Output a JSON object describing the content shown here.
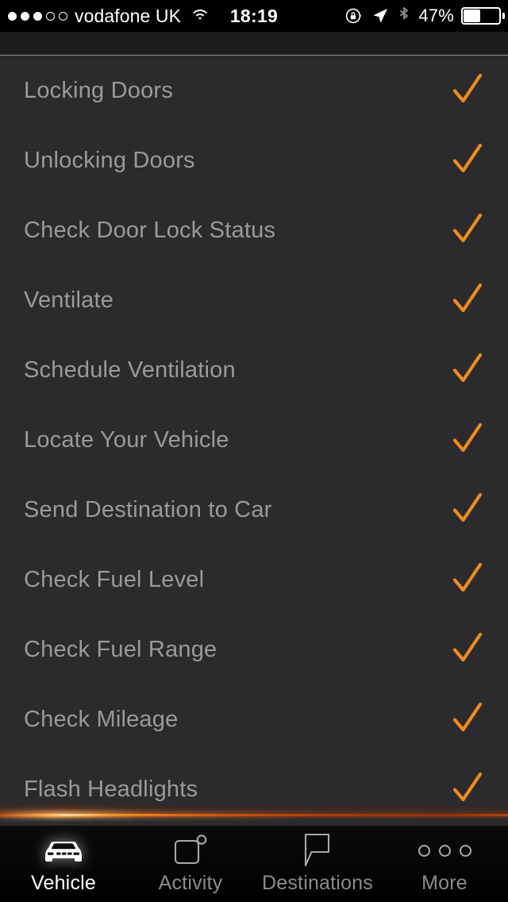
{
  "statusbar": {
    "signal_dots_filled": 3,
    "signal_dots_total": 5,
    "carrier": "vodafone UK",
    "wifi_icon": "wifi-icon",
    "time": "18:19",
    "rotation_lock_icon": "rotation-lock-icon",
    "location_icon": "location-arrow-icon",
    "bluetooth_icon": "bluetooth-icon",
    "battery_percent": "47%",
    "battery_level": 47
  },
  "list": {
    "items": [
      {
        "label": "Locking Doors",
        "checked": true
      },
      {
        "label": "Unlocking Doors",
        "checked": true
      },
      {
        "label": "Check Door Lock Status",
        "checked": true
      },
      {
        "label": "Ventilate",
        "checked": true
      },
      {
        "label": "Schedule Ventilation",
        "checked": true
      },
      {
        "label": "Locate Your Vehicle",
        "checked": true
      },
      {
        "label": "Send Destination to Car",
        "checked": true
      },
      {
        "label": "Check Fuel Level",
        "checked": true
      },
      {
        "label": "Check Fuel Range",
        "checked": true
      },
      {
        "label": "Check Mileage",
        "checked": true
      },
      {
        "label": "Flash Headlights",
        "checked": true
      }
    ],
    "check_color": "#ef8b1f",
    "label_color": "#9a9a9d",
    "background_color": "#2b2b2d"
  },
  "tabbar": {
    "accent_color": "#f09020",
    "tabs": [
      {
        "label": "Vehicle",
        "icon": "car-front-icon",
        "active": true
      },
      {
        "label": "Activity",
        "icon": "square-badge-icon",
        "active": false
      },
      {
        "label": "Destinations",
        "icon": "map-pin-flag-icon",
        "active": false
      },
      {
        "label": "More",
        "icon": "ellipsis-icon",
        "active": false
      }
    ]
  }
}
